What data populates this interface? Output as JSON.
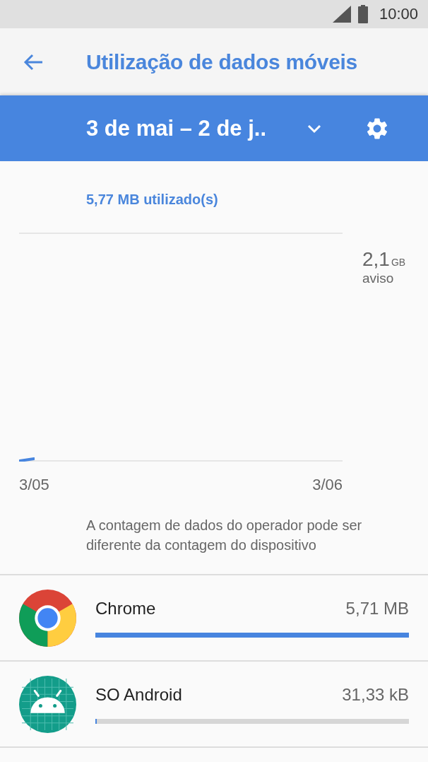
{
  "status_bar": {
    "time": "10:00"
  },
  "toolbar": {
    "title": "Utilização de dados móveis"
  },
  "cycle_bar": {
    "period": "3 de mai – 2 de j.."
  },
  "usage": {
    "summary": "5,77 MB utilizado(s)",
    "warning_value": "2,1",
    "warning_unit": "GB",
    "warning_label": "aviso",
    "x_labels": [
      "3/05",
      "3/06"
    ]
  },
  "note": "A contagem de dados do operador pode ser diferente da contagem do dispositivo",
  "apps": [
    {
      "kind": "chrome",
      "name": "Chrome",
      "amount": "5,71 MB",
      "level": 1
    },
    {
      "kind": "android",
      "name": "SO Android",
      "amount": "31,33 kB",
      "level": 0.005
    }
  ]
}
